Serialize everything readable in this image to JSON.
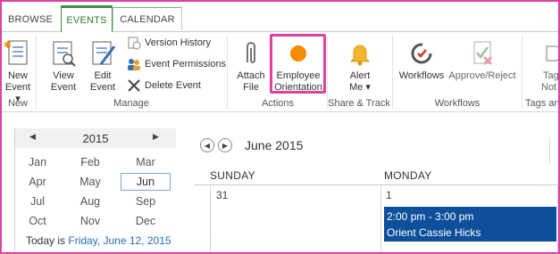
{
  "ribbon_tabs": [
    "BROWSE",
    "EVENTS",
    "CALENDAR"
  ],
  "active_tab": "EVENTS",
  "ribbon": {
    "new": {
      "label_line1": "New",
      "label_line2": "Event",
      "dropdown": "▾"
    },
    "group_new": "New",
    "view_event": {
      "line1": "View",
      "line2": "Event"
    },
    "edit_event": {
      "line1": "Edit",
      "line2": "Event"
    },
    "version_history": "Version History",
    "event_permissions": "Event Permissions",
    "delete_event": "Delete Event",
    "group_manage": "Manage",
    "attach_file": {
      "line1": "Attach",
      "line2": "File"
    },
    "employee_orientation": {
      "line1": "Employee",
      "line2": "Orientation"
    },
    "group_actions": "Actions",
    "alert_me": {
      "line1": "Alert",
      "line2": "Me",
      "dropdown": "▾"
    },
    "group_share": "Share & Track",
    "workflows": "Workflows",
    "approve_reject": "Approve/Reject",
    "group_workflows": "Workflows",
    "tags_notes": {
      "line1": "Tags",
      "line2": "Not"
    },
    "group_tags": "Tags and",
    "accent_orange": "#f28c00",
    "highlight_color": "#e040a0"
  },
  "date_picker": {
    "year": "2015",
    "prev_icon": "◀",
    "next_icon": "▶",
    "months": [
      "Jan",
      "Feb",
      "Mar",
      "Apr",
      "May",
      "Jun",
      "Jul",
      "Aug",
      "Sep",
      "Oct",
      "Nov",
      "Dec"
    ],
    "selected_month": "Jun",
    "today_prefix": "Today is",
    "today_link": "Friday, June 12, 2015"
  },
  "calendar": {
    "prev_icon": "◀",
    "next_icon": "▶",
    "month_title": "June 2015",
    "day_headers": [
      "SUNDAY",
      "MONDAY"
    ],
    "day_numbers": [
      "31",
      "1"
    ],
    "event": {
      "time": "2:00 pm - 3:00 pm",
      "title": "Orient Cassie Hicks",
      "color": "#0d4f9a"
    }
  }
}
